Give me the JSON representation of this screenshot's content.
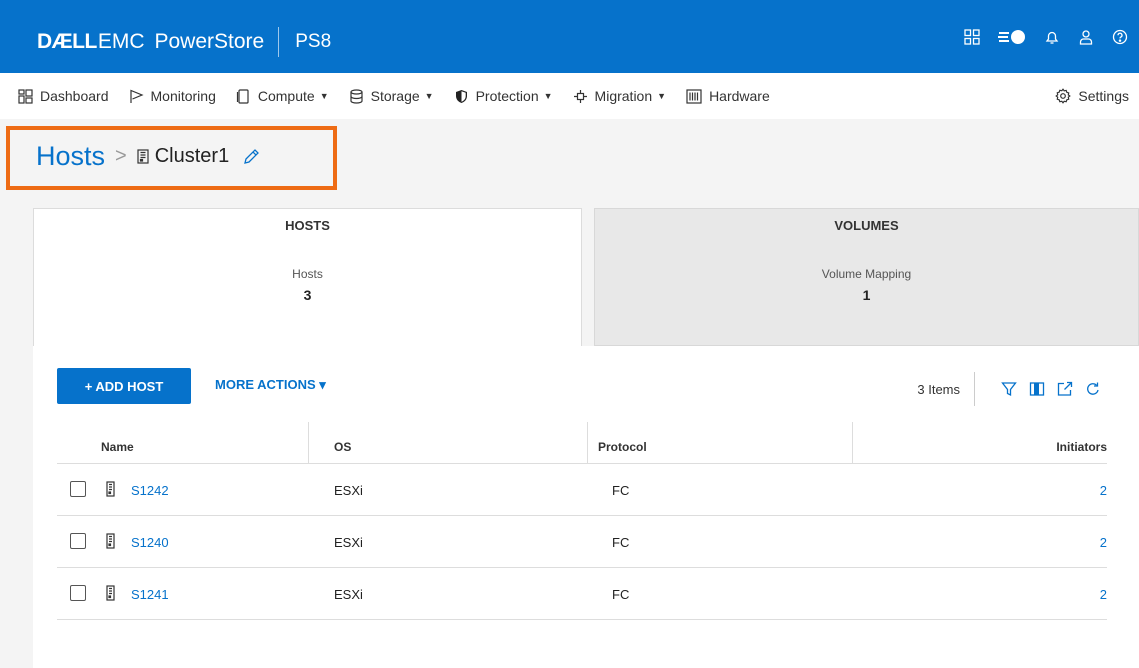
{
  "header": {
    "brand_dell": "DÆLL",
    "brand_emc": "EMC",
    "brand_product": "PowerStore",
    "system_name": "PS8",
    "icons": [
      "grid-icon",
      "capacity-icon",
      "bell-icon",
      "user-icon",
      "help-icon"
    ]
  },
  "nav": {
    "items": [
      {
        "label": "Dashboard",
        "icon": "dashboard-icon",
        "caret": ""
      },
      {
        "label": "Monitoring",
        "icon": "flag-icon",
        "caret": ""
      },
      {
        "label": "Compute",
        "icon": "compute-icon",
        "caret": "▼"
      },
      {
        "label": "Storage",
        "icon": "storage-icon",
        "caret": "▼"
      },
      {
        "label": "Protection",
        "icon": "shield-icon",
        "caret": "▼"
      },
      {
        "label": "Migration",
        "icon": "migration-icon",
        "caret": "▼"
      },
      {
        "label": "Hardware",
        "icon": "hardware-icon",
        "caret": ""
      }
    ],
    "settings": {
      "label": "Settings",
      "icon": "gear-icon"
    }
  },
  "breadcrumb": {
    "parent": "Hosts",
    "separator": ">",
    "current": "Cluster1"
  },
  "tiles": [
    {
      "title": "HOSTS",
      "label": "Hosts",
      "value": "3",
      "active": true
    },
    {
      "title": "VOLUMES",
      "label": "Volume Mapping",
      "value": "1",
      "active": false
    }
  ],
  "actions": {
    "add_host": "+ ADD HOST",
    "more_actions": "MORE ACTIONS ▾",
    "items_count": "3 Items"
  },
  "table": {
    "columns": [
      "Name",
      "OS",
      "Protocol",
      "Initiators"
    ],
    "rows": [
      {
        "name": "S1242",
        "os": "ESXi",
        "protocol": "FC",
        "initiators": "2"
      },
      {
        "name": "S1240",
        "os": "ESXi",
        "protocol": "FC",
        "initiators": "2"
      },
      {
        "name": "S1241",
        "os": "ESXi",
        "protocol": "FC",
        "initiators": "2"
      }
    ]
  },
  "colors": {
    "brand_blue": "#0672cb",
    "highlight_orange": "#ee6b14"
  }
}
